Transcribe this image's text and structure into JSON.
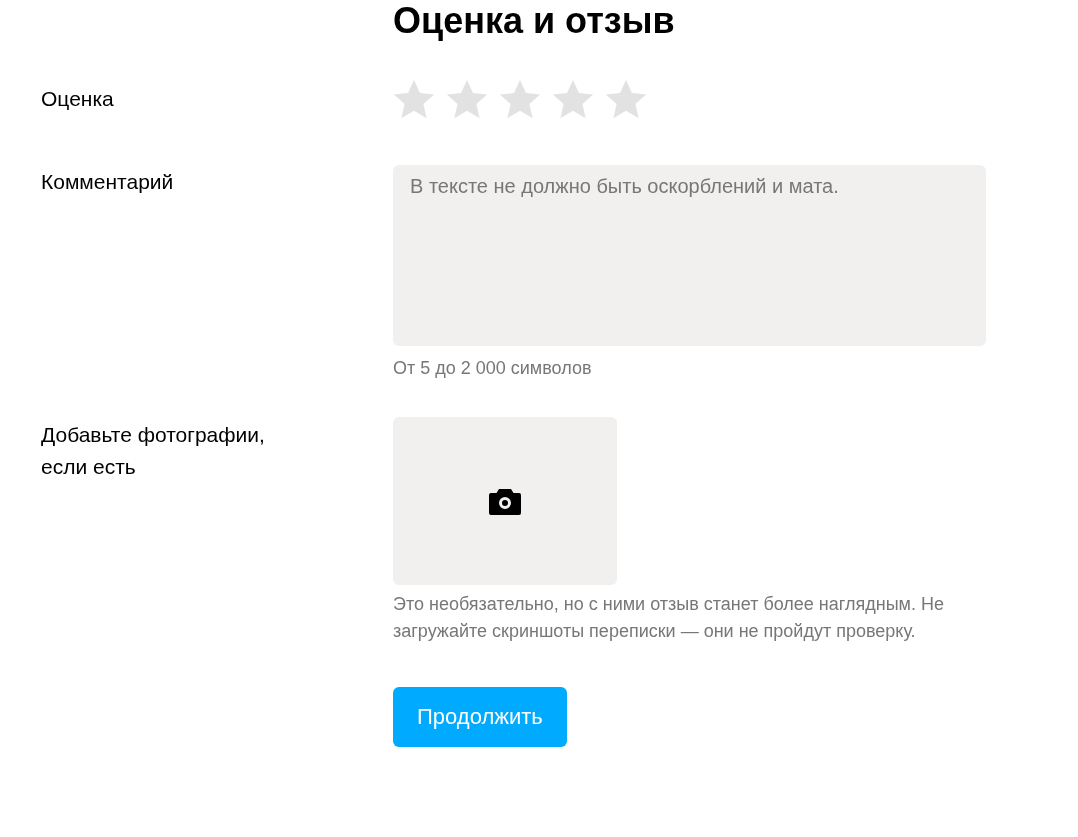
{
  "title": "Оценка и отзыв",
  "rating": {
    "label": "Оценка",
    "stars": 0
  },
  "comment": {
    "label": "Комментарий",
    "placeholder": "В тексте не должно быть оскорблений и мата.",
    "hint": "От 5 до 2 000 символов"
  },
  "photos": {
    "label": "Добавьте фотографии, если есть",
    "hint": "Это необязательно, но с ними отзыв станет более наглядным. Не загружайте скриншоты переписки — они не пройдут проверку."
  },
  "button": {
    "label": "Продолжить"
  }
}
